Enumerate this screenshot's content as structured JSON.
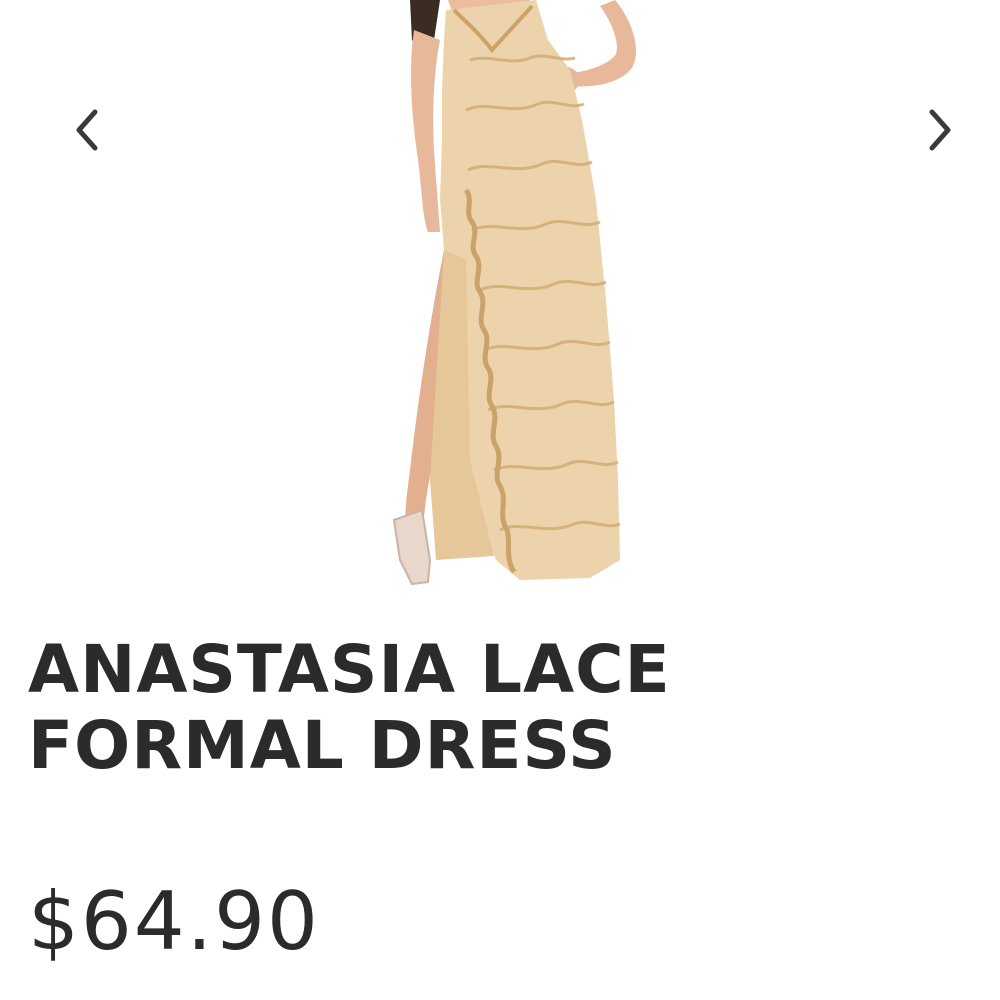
{
  "gallery": {
    "prev_icon": "chevron-left-icon",
    "next_icon": "chevron-right-icon"
  },
  "product": {
    "title_line1": "ANASTASIA LACE",
    "title_line2": "FORMAL DRESS",
    "price": "$64.90"
  },
  "colors": {
    "text": "#2b2b2b",
    "background": "#ffffff",
    "dress": "#ecd3ac",
    "lace": "#d9b884"
  }
}
